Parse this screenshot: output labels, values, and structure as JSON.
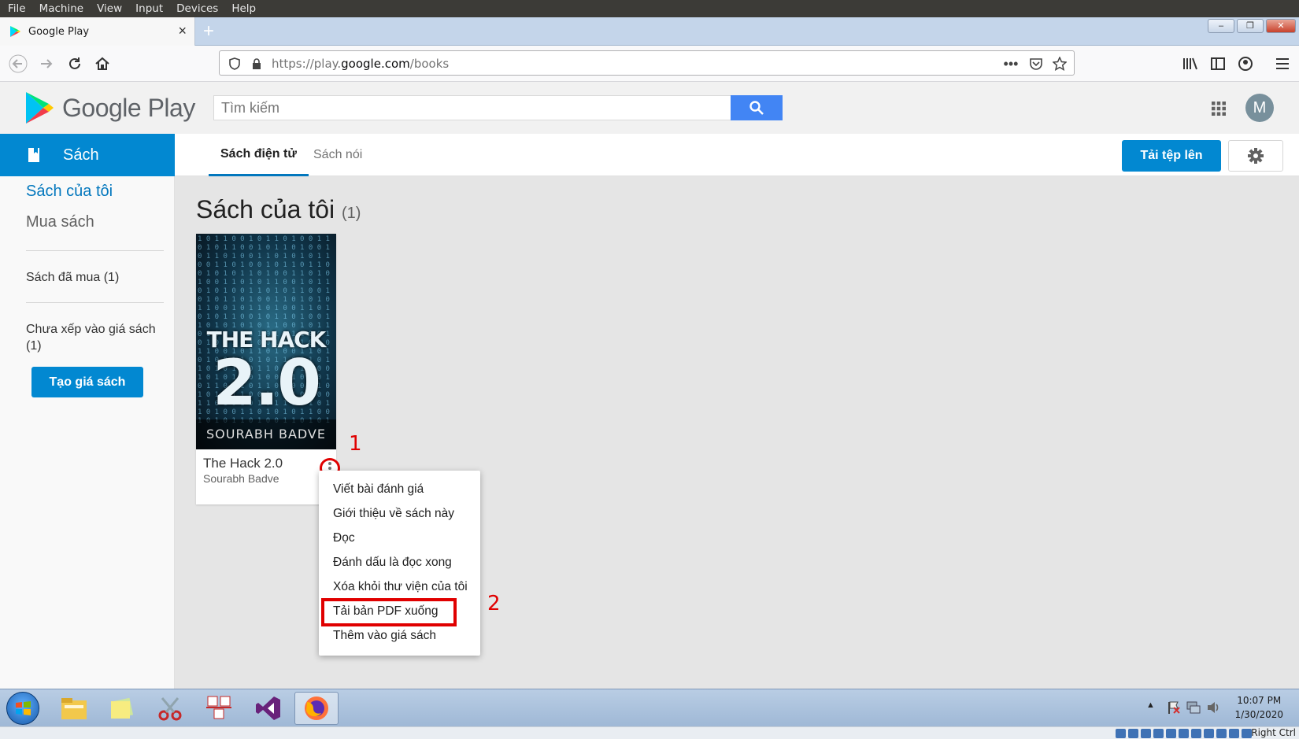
{
  "vm_menu": [
    "File",
    "Machine",
    "View",
    "Input",
    "Devices",
    "Help"
  ],
  "browser": {
    "tab_title": "Google Play",
    "url_prefix": "https://play.",
    "url_domain": "google.com",
    "url_path": "/books"
  },
  "play": {
    "logo_text": "Google Play",
    "search_placeholder": "Tìm kiếm",
    "avatar_letter": "M",
    "colors": {
      "accent": "#0288d1",
      "search_button": "#4285f4",
      "highlight": "#e00000"
    }
  },
  "sidebar": {
    "section_label": "Sách",
    "link_my_books": "Sách của tôi",
    "link_shop": "Mua sách",
    "purchased": "Sách đã mua (1)",
    "unshelved": "Chưa xếp vào giá sách (1)",
    "create_shelf": "Tạo giá sách"
  },
  "subnav": {
    "tab_ebooks": "Sách điện tử",
    "tab_audiobooks": "Sách nói",
    "upload_button": "Tải tệp lên"
  },
  "main": {
    "title": "Sách của tôi",
    "count": "(1)"
  },
  "book": {
    "cover_title": "THE HACK",
    "cover_number": "2.0",
    "cover_author": "SOURABH BADVE",
    "title": "The Hack 2.0",
    "author": "Sourabh Badve"
  },
  "context_menu": {
    "items": [
      "Viết bài đánh giá",
      "Giới thiệu về sách này",
      "Đọc",
      "Đánh dấu là đọc xong",
      "Xóa khỏi thư viện của tôi",
      "Tải bản PDF xuống",
      "Thêm vào giá sách"
    ]
  },
  "annotations": {
    "step1": "1",
    "step2": "2"
  },
  "taskbar": {
    "time": "10:07 PM",
    "date": "1/30/2020",
    "host_key": "Right Ctrl"
  }
}
